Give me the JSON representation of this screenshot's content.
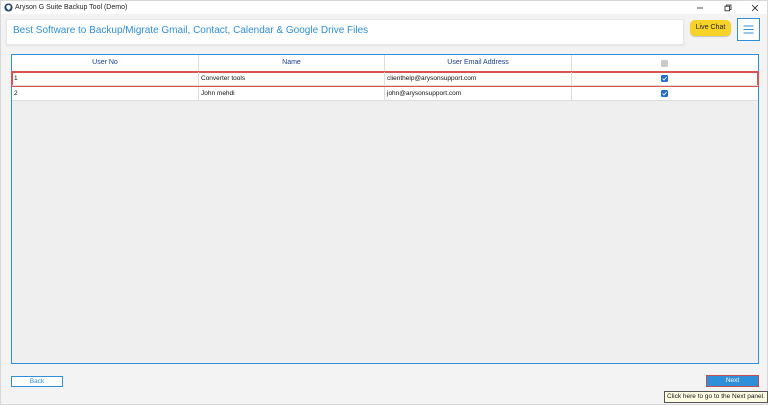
{
  "window": {
    "title": "Aryson G Suite Backup Tool (Demo)",
    "icon": "app-shield-icon",
    "controls": [
      "minimize-icon",
      "restore-icon",
      "close-icon"
    ]
  },
  "header": {
    "title": "Best Software to Backup/Migrate Gmail, Contact, Calendar & Google Drive Files",
    "title_color": "#2f8fd8",
    "live_chat_label": "Live Chat",
    "live_chat_color": "#f7d229",
    "menu_icon": "hamburger-icon"
  },
  "table": {
    "columns": [
      "User No",
      "Name",
      "User Email Address",
      ""
    ],
    "header_checkbox_checked": false,
    "rows": [
      {
        "no": "1",
        "name": "Converter tools",
        "email": "clienthelp@arysonsupport.com",
        "checked": true,
        "selected": true
      },
      {
        "no": "2",
        "name": "John mehdi",
        "email": "john@arysonsupport.com",
        "checked": true,
        "selected": false
      }
    ]
  },
  "footer": {
    "back_label": "Back",
    "next_label": "Next",
    "tooltip": "Click here to go to the Next panel."
  }
}
